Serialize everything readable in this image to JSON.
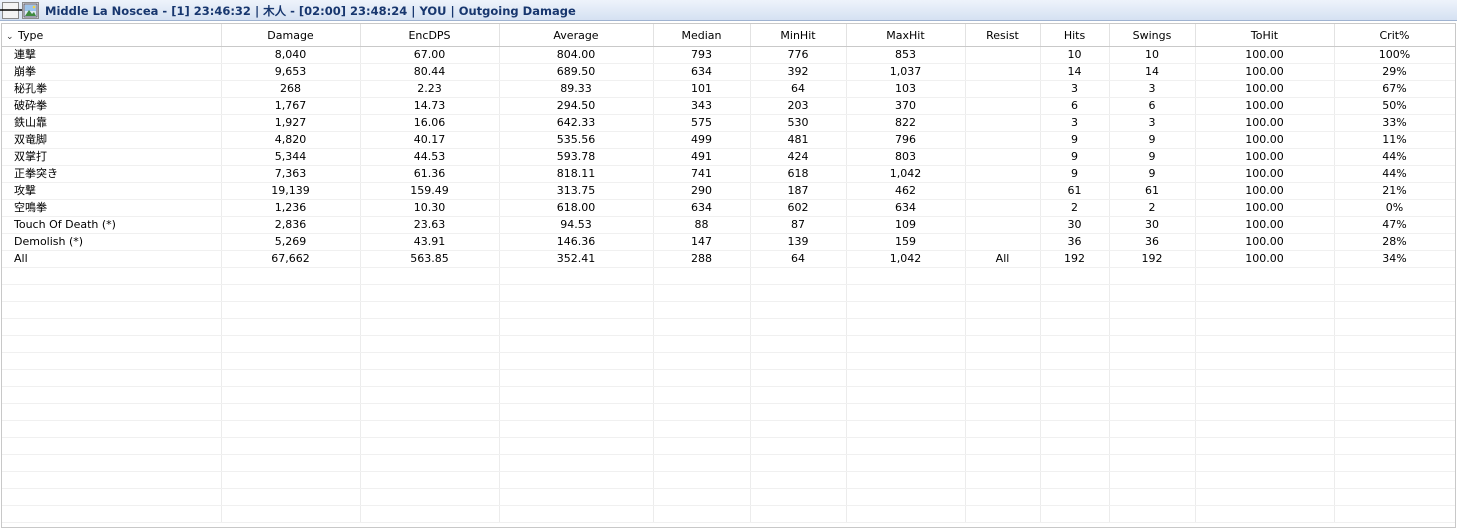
{
  "window": {
    "title": "Middle La Noscea - [1] 23:46:32 | 木人 - [02:00] 23:48:24 | YOU | Outgoing Damage"
  },
  "icons": {
    "back": "arrow-left-icon",
    "image": "picture-icon",
    "sort": "chevron-down-icon"
  },
  "table": {
    "columns": [
      "Type",
      "Damage",
      "EncDPS",
      "Average",
      "Median",
      "MinHit",
      "MaxHit",
      "Resist",
      "Hits",
      "Swings",
      "ToHit",
      "Crit%"
    ],
    "rows": [
      [
        "連撃",
        "8,040",
        "67.00",
        "804.00",
        "793",
        "776",
        "853",
        "",
        "10",
        "10",
        "100.00",
        "100%"
      ],
      [
        "崩拳",
        "9,653",
        "80.44",
        "689.50",
        "634",
        "392",
        "1,037",
        "",
        "14",
        "14",
        "100.00",
        "29%"
      ],
      [
        "秘孔拳",
        "268",
        "2.23",
        "89.33",
        "101",
        "64",
        "103",
        "",
        "3",
        "3",
        "100.00",
        "67%"
      ],
      [
        "破砕拳",
        "1,767",
        "14.73",
        "294.50",
        "343",
        "203",
        "370",
        "",
        "6",
        "6",
        "100.00",
        "50%"
      ],
      [
        "鉄山靠",
        "1,927",
        "16.06",
        "642.33",
        "575",
        "530",
        "822",
        "",
        "3",
        "3",
        "100.00",
        "33%"
      ],
      [
        "双竜脚",
        "4,820",
        "40.17",
        "535.56",
        "499",
        "481",
        "796",
        "",
        "9",
        "9",
        "100.00",
        "11%"
      ],
      [
        "双掌打",
        "5,344",
        "44.53",
        "593.78",
        "491",
        "424",
        "803",
        "",
        "9",
        "9",
        "100.00",
        "44%"
      ],
      [
        "正拳突き",
        "7,363",
        "61.36",
        "818.11",
        "741",
        "618",
        "1,042",
        "",
        "9",
        "9",
        "100.00",
        "44%"
      ],
      [
        "攻撃",
        "19,139",
        "159.49",
        "313.75",
        "290",
        "187",
        "462",
        "",
        "61",
        "61",
        "100.00",
        "21%"
      ],
      [
        "空鳴拳",
        "1,236",
        "10.30",
        "618.00",
        "634",
        "602",
        "634",
        "",
        "2",
        "2",
        "100.00",
        "0%"
      ],
      [
        "Touch Of Death (*)",
        "2,836",
        "23.63",
        "94.53",
        "88",
        "87",
        "109",
        "",
        "30",
        "30",
        "100.00",
        "47%"
      ],
      [
        "Demolish (*)",
        "5,269",
        "43.91",
        "146.36",
        "147",
        "139",
        "159",
        "",
        "36",
        "36",
        "100.00",
        "28%"
      ],
      [
        "All",
        "67,662",
        "563.85",
        "352.41",
        "288",
        "64",
        "1,042",
        "All",
        "192",
        "192",
        "100.00",
        "34%"
      ]
    ]
  }
}
